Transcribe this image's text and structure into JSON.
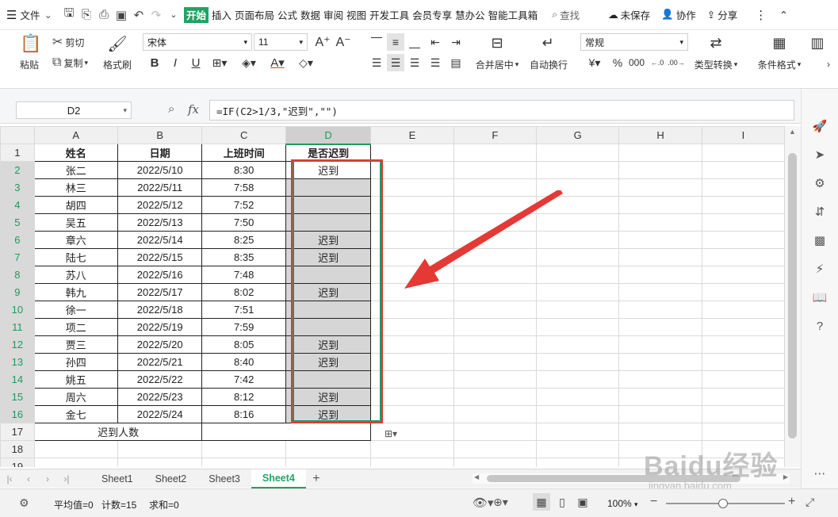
{
  "menubar": {
    "file_label": "文件",
    "items": [
      "开始",
      "插入",
      "页面布局",
      "公式",
      "数据",
      "审阅",
      "视图",
      "开发工具",
      "会员专享",
      "慧办公",
      "智能工具箱"
    ],
    "search_label": "查找",
    "unsaved_label": "未保存",
    "collab_label": "协作",
    "share_label": "分享"
  },
  "ribbon": {
    "paste": "粘贴",
    "cut": "剪切",
    "copy": "复制",
    "format_painter": "格式刷",
    "font_name": "宋体",
    "font_size": "11",
    "merge": "合并居中",
    "wrap": "自动换行",
    "number_format": "常规",
    "type_convert": "类型转换",
    "cond_format": "条件格式"
  },
  "formula_bar": {
    "cell_ref": "D2",
    "fx": "fx",
    "formula": "=IF(C2>1/3,\"迟到\",\"\")"
  },
  "columns": [
    "A",
    "B",
    "C",
    "D",
    "E",
    "F",
    "G",
    "H",
    "I"
  ],
  "header_row": [
    "姓名",
    "日期",
    "上班时间",
    "是否迟到"
  ],
  "rows": [
    [
      "张二",
      "2022/5/10",
      "8:30",
      "迟到"
    ],
    [
      "林三",
      "2022/5/11",
      "7:58",
      ""
    ],
    [
      "胡四",
      "2022/5/12",
      "7:52",
      ""
    ],
    [
      "吴五",
      "2022/5/13",
      "7:50",
      ""
    ],
    [
      "章六",
      "2022/5/14",
      "8:25",
      "迟到"
    ],
    [
      "陆七",
      "2022/5/15",
      "8:35",
      "迟到"
    ],
    [
      "苏八",
      "2022/5/16",
      "7:48",
      ""
    ],
    [
      "韩九",
      "2022/5/17",
      "8:02",
      "迟到"
    ],
    [
      "徐一",
      "2022/5/18",
      "7:51",
      ""
    ],
    [
      "项二",
      "2022/5/19",
      "7:59",
      ""
    ],
    [
      "贾三",
      "2022/5/20",
      "8:05",
      "迟到"
    ],
    [
      "孙四",
      "2022/5/21",
      "8:40",
      "迟到"
    ],
    [
      "姚五",
      "2022/5/22",
      "7:42",
      ""
    ],
    [
      "周六",
      "2022/5/23",
      "8:12",
      "迟到"
    ],
    [
      "金七",
      "2022/5/24",
      "8:16",
      "迟到"
    ]
  ],
  "summary_label": "迟到人数",
  "sheets": [
    "Sheet1",
    "Sheet2",
    "Sheet3",
    "Sheet4"
  ],
  "active_sheet": "Sheet4",
  "status": {
    "average": "平均值=0",
    "count": "计数=15",
    "sum": "求和=0",
    "zoom": "100%"
  },
  "watermark": "Baidu经验",
  "watermark_sub": "jingyan.baidu.com",
  "colors": {
    "accent": "#1fa463",
    "annotation": "#e53935"
  }
}
